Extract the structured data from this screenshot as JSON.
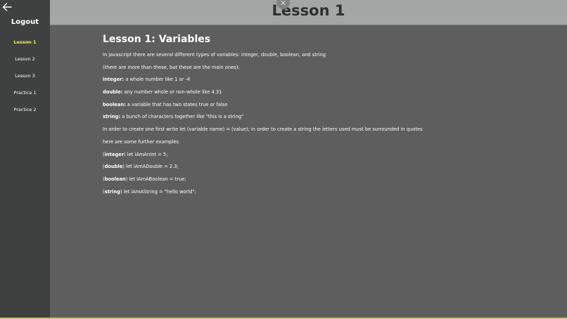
{
  "header": {
    "title": "Lesson 1"
  },
  "sidebar": {
    "logout_label": "Logout",
    "items": [
      {
        "label": "Lesson 1",
        "active": true
      },
      {
        "label": "Lesson 2",
        "active": false
      },
      {
        "label": "Lesson 3",
        "active": false
      },
      {
        "label": "Practice 1",
        "active": false
      },
      {
        "label": "Practice 2",
        "active": false
      }
    ]
  },
  "lesson": {
    "heading": "Lesson 1: Variables",
    "intro": "In javascript there are several different types of variables: integer, double, boolean, and string",
    "intro_note": "(there are more than these, but these are the main ones):",
    "types": [
      {
        "term": "integer:",
        "desc": " a whole number like 1 or -4"
      },
      {
        "term": "double:",
        "desc": " any number whole or non-whole like 4.31"
      },
      {
        "term": "boolean:",
        "desc": " a variable that has two states true or false"
      },
      {
        "term": "string:",
        "desc": " a bunch of characters together like \"this is a string\""
      }
    ],
    "create_note": "In order to create one first write let (variable name) = (value); in order to create a string the letters used must be surrounded in quotes",
    "examples_note": "here are some further examples",
    "examples": [
      {
        "open": "(",
        "term": "integer",
        "code": ") let iAmAnInt = 5;"
      },
      {
        "open": "(",
        "term": "double",
        "code": ") let iAmADouble = 2.3;"
      },
      {
        "open": "(",
        "term": "boolean",
        "code": ") let iAmABoolean = true;"
      },
      {
        "open": "(",
        "term": "string",
        "code": ") let iAmAString = \"hello world\";"
      }
    ]
  },
  "colors": {
    "sidebar_bg": "#3f4140",
    "header_bg": "#a2a7a5",
    "content_bg": "#5e5e5e",
    "active_nav": "#f3f35a",
    "accent_bar": "#c9c955"
  },
  "icons": {
    "back": "arrow-left-icon",
    "close": "close-icon"
  }
}
